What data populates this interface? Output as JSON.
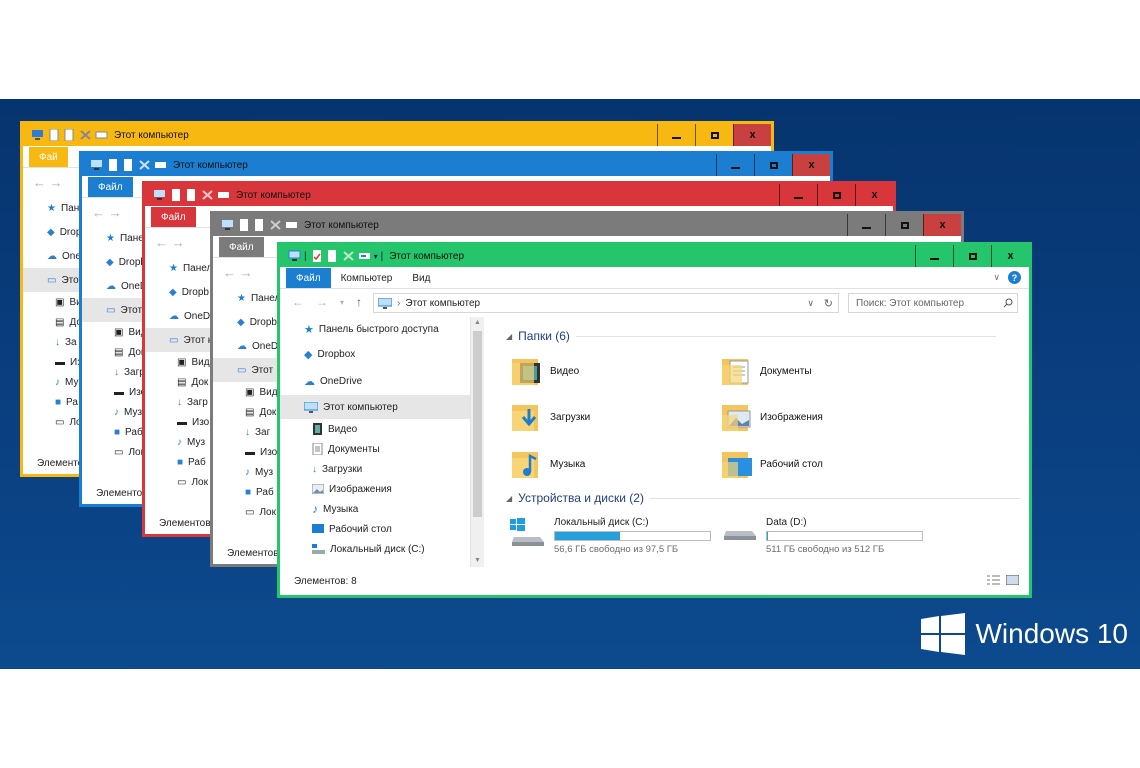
{
  "brand": {
    "text": "Windows 10"
  },
  "colors": {
    "yellow": "#f8b812",
    "blue": "#1b7ed0",
    "red": "#d9363b",
    "gray": "#7b7b7b",
    "green": "#25c56b",
    "accent": "#26a0da"
  },
  "back_windows": {
    "yellow": {
      "title": "Этот компьютер",
      "file_tab": "Фай",
      "tree": [
        "Панел",
        "Dropb",
        "OneD",
        "Этот к"
      ],
      "sub": [
        "Ви",
        "До",
        "За",
        "Из",
        "Му",
        "Ра",
        "Ло"
      ],
      "status": "Элементов"
    },
    "blue": {
      "title": "Этот компьютер",
      "file_tab": "Файл",
      "tree": [
        "Панел",
        "Dropb",
        "OneD",
        "Этот к"
      ],
      "sub": [
        "Вид",
        "Док",
        "Загр",
        "Изо",
        "Муз",
        "Раб",
        "Лок"
      ],
      "status": "Элементов"
    },
    "red": {
      "title": "Этот компьютер",
      "file_tab": "Файл",
      "tree": [
        "Панел",
        "Dropb",
        "OneD",
        "Этот к"
      ],
      "sub": [
        "Вид",
        "Док",
        "Загр",
        "Изо",
        "Муз",
        "Раб",
        "Лок"
      ],
      "status": "Элементов"
    },
    "gray": {
      "title": "Этот компьютер",
      "file_tab": "Файл",
      "tree": [
        "Панел",
        "Dropb",
        "OneD",
        "Этот"
      ],
      "sub": [
        "Вид",
        "Док",
        "Заг",
        "Изо",
        "Муз",
        "Раб",
        "Лок"
      ],
      "status": "Элементов"
    }
  },
  "front": {
    "title": "Этот компьютер",
    "tabs": [
      "Файл",
      "Компьютер",
      "Вид"
    ],
    "address": "Этот компьютер",
    "search_placeholder": "Поиск: Этот компьютер",
    "tree": {
      "quick": "Панель быстрого доступа",
      "dropbox": "Dropbox",
      "onedrive": "OneDrive",
      "thispc": "Этот компьютер",
      "sub": [
        "Видео",
        "Документы",
        "Загрузки",
        "Изображения",
        "Музыка",
        "Рабочий стол",
        "Локальный диск (C:)"
      ]
    },
    "status": "Элементов: 8",
    "folders_header": "Папки (6)",
    "folders": [
      "Видео",
      "Документы",
      "Загрузки",
      "Изображения",
      "Музыка",
      "Рабочий стол"
    ],
    "devices_header": "Устройства и диски (2)",
    "drives": [
      {
        "name": "Локальный диск (C:)",
        "free": "56,6 ГБ свободно из 97,5 ГБ",
        "used_fraction": 0.42
      },
      {
        "name": "Data (D:)",
        "free": "511 ГБ свободно из 512 ГБ",
        "used_fraction": 0.002
      }
    ]
  }
}
